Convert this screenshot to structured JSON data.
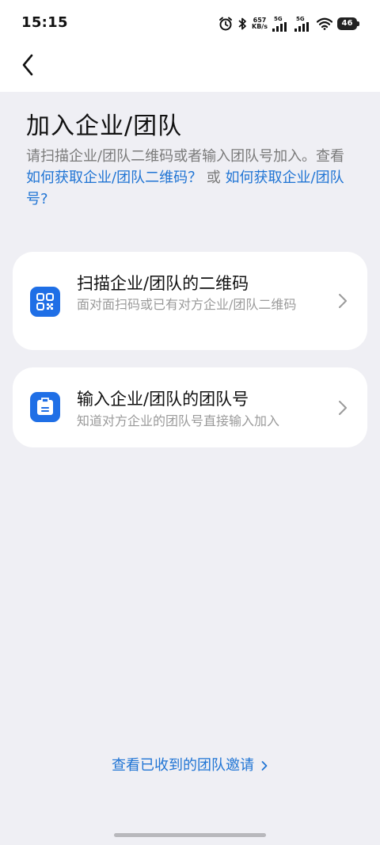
{
  "status_bar": {
    "time": "15:15",
    "net_speed_value": "657",
    "net_speed_unit": "KB/s",
    "sim1_tag": "5G",
    "sim2_tag": "5G",
    "battery_level": "46",
    "icons": [
      "alarm-icon",
      "bluetooth-icon",
      "signal-icon",
      "signal-icon",
      "wifi-icon",
      "battery-icon"
    ]
  },
  "header": {
    "back_icon": "chevron-left-icon"
  },
  "page": {
    "title": "加入企业/团队",
    "description_prefix": "请扫描企业/团队二维码或者输入团队号加入。查看 ",
    "link_qr": "如何获取企业/团队二维码？",
    "connector": " 或 ",
    "link_team_no": "如何获取企业/团队号?"
  },
  "options": [
    {
      "icon": "qr-code-icon",
      "title": "扫描企业/团队的二维码",
      "subtitle": "面对面扫码或已有对方企业/团队二维码"
    },
    {
      "icon": "badge-icon",
      "title": "输入企业/团队的团队号",
      "subtitle": "知道对方企业的团队号直接输入加入"
    }
  ],
  "footer": {
    "invite_link": "查看已收到的团队邀请"
  },
  "colors": {
    "accent": "#1f74d4",
    "icon_bg": "#1f6fe6",
    "page_bg": "#efeff4"
  }
}
